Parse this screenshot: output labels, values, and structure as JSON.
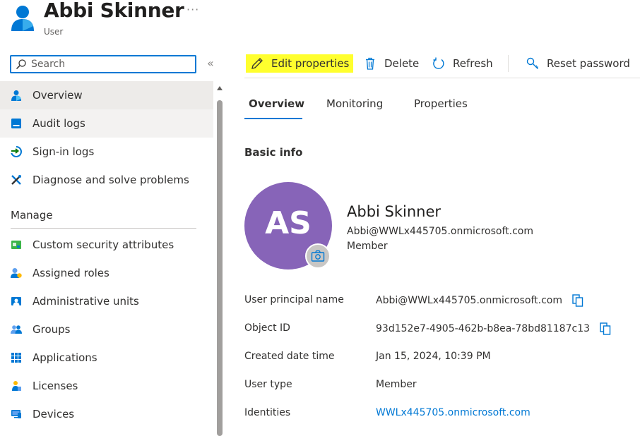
{
  "header": {
    "title": "Abbi Skinner",
    "subtitle": "User",
    "more": "···",
    "icon": "user-icon"
  },
  "sidebar": {
    "search_placeholder": "Search",
    "collapse": "«",
    "items": [
      {
        "label": "Overview",
        "icon": "user-icon"
      },
      {
        "label": "Audit logs",
        "icon": "audit-log-icon"
      },
      {
        "label": "Sign-in logs",
        "icon": "sign-in-icon"
      },
      {
        "label": "Diagnose and solve problems",
        "icon": "wrench-icon"
      }
    ],
    "section_label": "Manage",
    "manage_items": [
      {
        "label": "Custom security attributes",
        "icon": "attributes-icon"
      },
      {
        "label": "Assigned roles",
        "icon": "roles-icon"
      },
      {
        "label": "Administrative units",
        "icon": "admin-units-icon"
      },
      {
        "label": "Groups",
        "icon": "groups-icon"
      },
      {
        "label": "Applications",
        "icon": "applications-icon"
      },
      {
        "label": "Licenses",
        "icon": "licenses-icon"
      },
      {
        "label": "Devices",
        "icon": "devices-icon"
      }
    ]
  },
  "toolbar": {
    "edit_label": "Edit properties",
    "delete_label": "Delete",
    "refresh_label": "Refresh",
    "reset_label": "Reset password"
  },
  "tabs": [
    {
      "label": "Overview",
      "active": true
    },
    {
      "label": "Monitoring",
      "active": false
    },
    {
      "label": "Properties",
      "active": false
    }
  ],
  "main": {
    "section_title": "Basic info",
    "avatar_initials": "AS",
    "profile_name": "Abbi Skinner",
    "profile_email": "Abbi@WWLx445705.onmicrosoft.com",
    "profile_role": "Member",
    "properties": [
      {
        "label": "User principal name",
        "value": "Abbi@WWLx445705.onmicrosoft.com"
      },
      {
        "label": "Object ID",
        "value": "93d152e7-4905-462b-b8ea-78bd81187c13"
      },
      {
        "label": "Created date time",
        "value": "Jan 15, 2024, 10:39 PM"
      },
      {
        "label": "User type",
        "value": "Member"
      },
      {
        "label": "Identities",
        "value": "WWLx445705.onmicrosoft.com"
      }
    ]
  },
  "colors": {
    "accent": "#0078d4",
    "avatar": "#8764b8",
    "highlight": "#ffff2e"
  }
}
